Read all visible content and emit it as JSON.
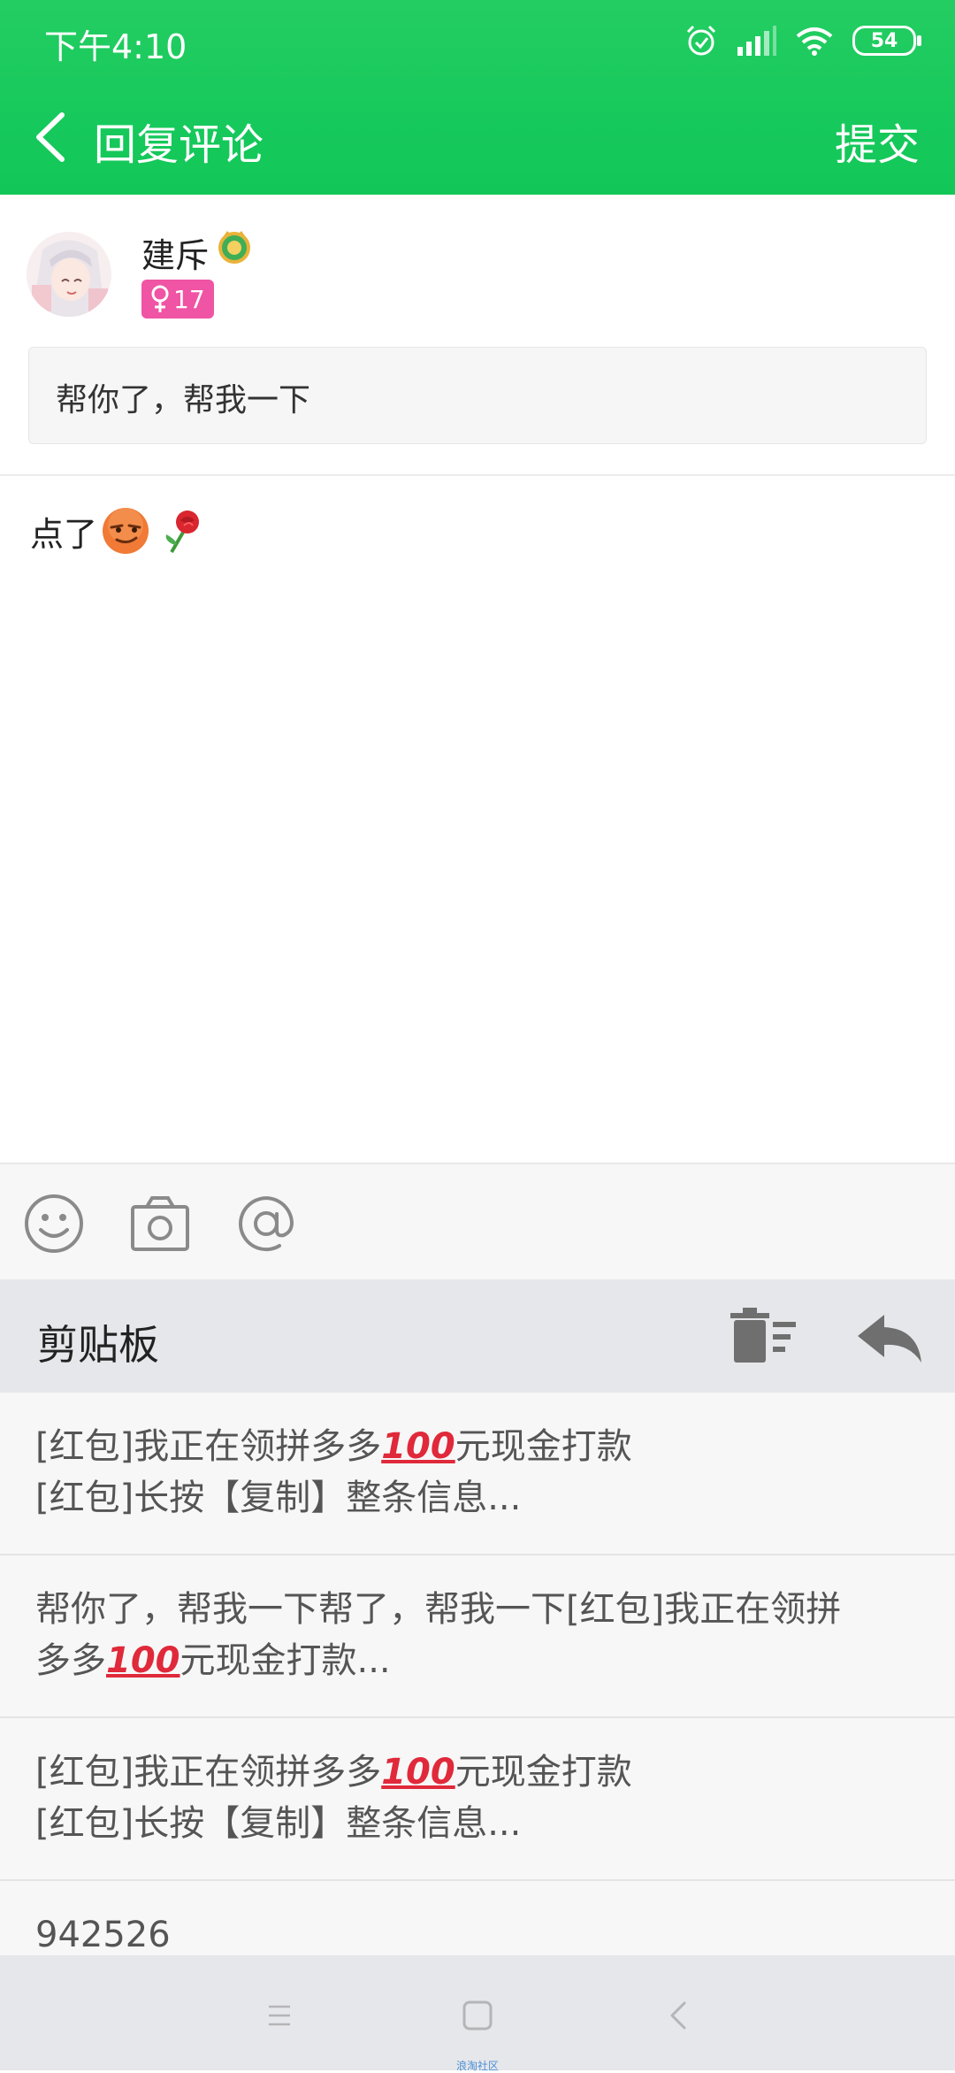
{
  "status_bar": {
    "time": "下午4:10",
    "battery": "54"
  },
  "nav": {
    "title": "回复评论",
    "submit_label": "提交"
  },
  "original_comment": {
    "username": "建斥",
    "gender_age": "17",
    "text": "帮你了，帮我一下"
  },
  "reply": {
    "text": "点了"
  },
  "clipboard": {
    "title": "剪贴板",
    "items": [
      {
        "line1_a": "[红包]我正在领拼多多",
        "line1_b": "元现金打款",
        "line2": "[红包]长按【复制】整条信息..."
      },
      {
        "line1": "帮你了，帮我一下帮了，帮我一下[红包]我正在领拼",
        "line2_a": "多多",
        "line2_b": "元现金打款..."
      },
      {
        "line1_a": "[红包]我正在领拼多多",
        "line1_b": "元现金打款",
        "line2": "[红包]长按【复制】整条信息..."
      },
      {
        "line1": "942526"
      }
    ],
    "hundred_emoji": "100"
  },
  "watermark": "浪淘社区",
  "colors": {
    "header_green": "#17c95c",
    "gender_pink": "#f054a4",
    "panel_gray": "#e6e7ea"
  },
  "icons": [
    "back-icon",
    "alarm-icon",
    "signal-icon",
    "wifi-icon",
    "battery-icon",
    "emoji-icon",
    "camera-icon",
    "at-icon",
    "trash-icon",
    "return-icon",
    "menu-icon",
    "home-icon",
    "back-nav-icon"
  ]
}
